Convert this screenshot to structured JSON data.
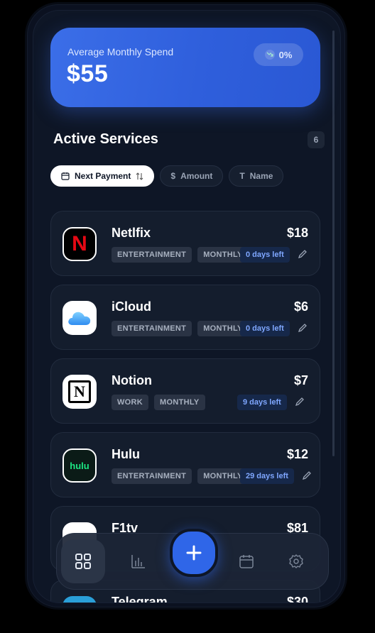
{
  "hero": {
    "label": "Average Monthly Spend",
    "amount": "$55",
    "trend": "0%"
  },
  "section": {
    "title": "Active Services",
    "count": "6"
  },
  "sort": [
    {
      "label": "Next Payment",
      "icon": "calendar-icon",
      "active": true
    },
    {
      "label": "Amount",
      "icon": "dollar-icon",
      "active": false
    },
    {
      "label": "Name",
      "icon": "text-icon",
      "active": false
    }
  ],
  "services": [
    {
      "name": "Netlfix",
      "price": "$18",
      "category": "ENTERTAINMENT",
      "cycle": "MONTHLY",
      "days_left": "0 days left",
      "logo_text": "N",
      "logo": "netflix-logo"
    },
    {
      "name": "iCloud",
      "price": "$6",
      "category": "ENTERTAINMENT",
      "cycle": "MONTHLY",
      "days_left": "0 days left",
      "logo": "icloud-logo"
    },
    {
      "name": "Notion",
      "price": "$7",
      "category": "WORK",
      "cycle": "MONTHLY",
      "days_left": "9 days left",
      "logo_text": "N",
      "logo": "notion-logo"
    },
    {
      "name": "Hulu",
      "price": "$12",
      "category": "ENTERTAINMENT",
      "cycle": "MONTHLY",
      "days_left": "29 days left",
      "logo_text": "hulu",
      "logo": "hulu-logo"
    },
    {
      "name": "F1tv",
      "price": "$81",
      "logo": "f1tv-logo"
    },
    {
      "name": "Telegram",
      "price": "$30",
      "logo": "telegram-logo"
    }
  ],
  "nav": [
    {
      "icon": "grid-icon",
      "active": true
    },
    {
      "icon": "bar-chart-icon",
      "active": false
    },
    {
      "icon": "plus-icon",
      "active": false
    },
    {
      "icon": "calendar-icon",
      "active": false
    },
    {
      "icon": "settings-icon",
      "active": false
    }
  ],
  "colors": {
    "accent": "#2f66e8",
    "background": "#0e1626",
    "card": "#141d2d"
  }
}
